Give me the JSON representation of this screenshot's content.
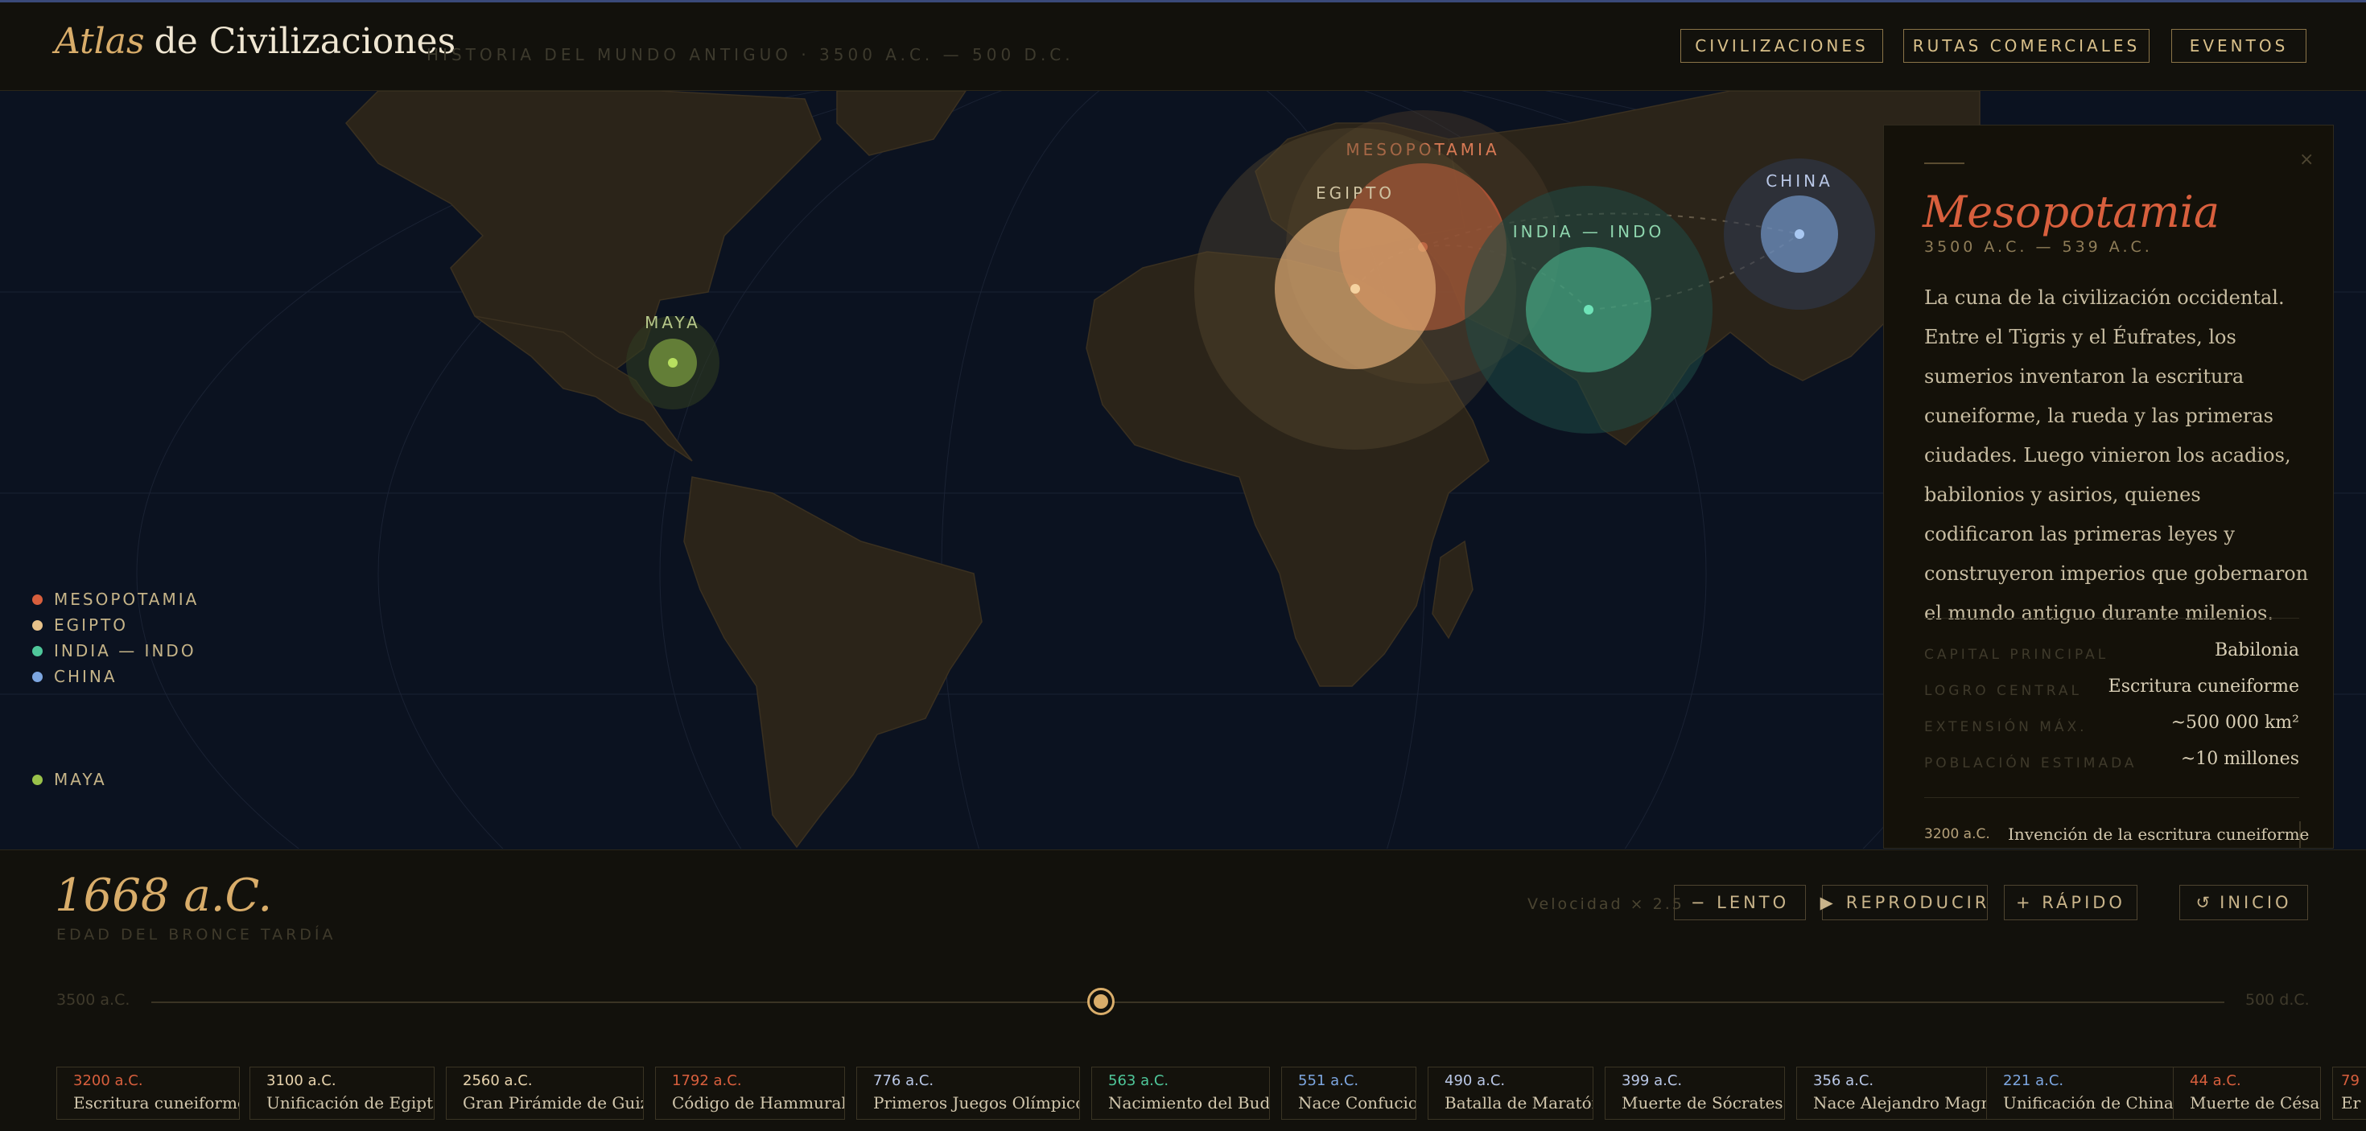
{
  "header": {
    "logo_italic": "Atlas",
    "logo_rest": "de Civilizaciones",
    "subtitle": "HISTORIA DEL MUNDO ANTIGUO · 3500 A.C. — 500 D.C.",
    "nav": [
      "CIVILIZACIONES",
      "RUTAS COMERCIALES",
      "EVENTOS"
    ]
  },
  "map": {
    "civilizations": [
      {
        "name": "MESOPOTAMIA",
        "color": "#d85f3d"
      },
      {
        "name": "EGIPTO",
        "color": "#e8b27a"
      },
      {
        "name": "INDIA — INDO",
        "color": "#4fc79a"
      },
      {
        "name": "CHINA",
        "color": "#7da6e0"
      },
      {
        "name": "MAYA",
        "color": "#9ac24a"
      }
    ],
    "legend": [
      "MESOPOTAMIA",
      "EGIPTO",
      "INDIA — INDO",
      "CHINA",
      "MAYA"
    ]
  },
  "panel": {
    "close": "×",
    "title": "Mesopotamia",
    "range": "3500 A.C. — 539 A.C.",
    "description": "La cuna de la civilización occidental. Entre el Tigris y el Éufrates, los sumerios inventaron la escritura cuneiforme, la rueda y las primeras ciudades. Luego vinieron los acadios, babilonios y asirios, quienes codificaron las primeras leyes y construyeron imperios que gobernaron el mundo antiguo durante milenios.",
    "stats": [
      {
        "label": "CAPITAL PRINCIPAL",
        "value": "Babilonia"
      },
      {
        "label": "LOGRO CENTRAL",
        "value": "Escritura cuneiforme"
      },
      {
        "label": "EXTENSIÓN MÁX.",
        "value": "~500 000 km²"
      },
      {
        "label": "POBLACIÓN ESTIMADA",
        "value": "~10 millones"
      }
    ],
    "event": {
      "year": "3200 a.C.",
      "text": "Invención de la escritura cuneiforme"
    }
  },
  "controls": {
    "year": "1668 a.C.",
    "era": "EDAD DEL BRONCE TARDÍA",
    "speed": "Velocidad × 2.5",
    "slow": "− LENTO",
    "play_icon": "▶",
    "play": "REPRODUCIR",
    "fast": "+ RÁPIDO",
    "reset_icon": "↺",
    "reset": "INICIO"
  },
  "timeline": {
    "start": "3500 a.C.",
    "end": "500 d.C.",
    "progress": 0.458,
    "events": [
      {
        "year": "3200 a.C.",
        "title": "Escritura cuneiforme",
        "color": "#d85f3d"
      },
      {
        "year": "3100 a.C.",
        "title": "Unificación de Egipto",
        "color": "#e8d4ae"
      },
      {
        "year": "2560 a.C.",
        "title": "Gran Pirámide de Guiza",
        "color": "#e8d4ae"
      },
      {
        "year": "1792 a.C.",
        "title": "Código de Hammurabi",
        "color": "#d85f3d"
      },
      {
        "year": "776 a.C.",
        "title": "Primeros Juegos Olímpicos",
        "color": "#b9c7e6"
      },
      {
        "year": "563 a.C.",
        "title": "Nacimiento del Buda",
        "color": "#4fc79a"
      },
      {
        "year": "551 a.C.",
        "title": "Nace Confucio",
        "color": "#7da6e0"
      },
      {
        "year": "490 a.C.",
        "title": "Batalla de Maratón",
        "color": "#b9c7e6"
      },
      {
        "year": "399 a.C.",
        "title": "Muerte de Sócrates",
        "color": "#b9c7e6"
      },
      {
        "year": "356 a.C.",
        "title": "Nace Alejandro Magno",
        "color": "#b9c7e6"
      },
      {
        "year": "221 a.C.",
        "title": "Unificación de China",
        "color": "#7da6e0"
      },
      {
        "year": "44 a.C.",
        "title": "Muerte de César",
        "color": "#d85f3d"
      },
      {
        "year": "79",
        "title": "Er",
        "color": "#d85f3d"
      }
    ]
  }
}
